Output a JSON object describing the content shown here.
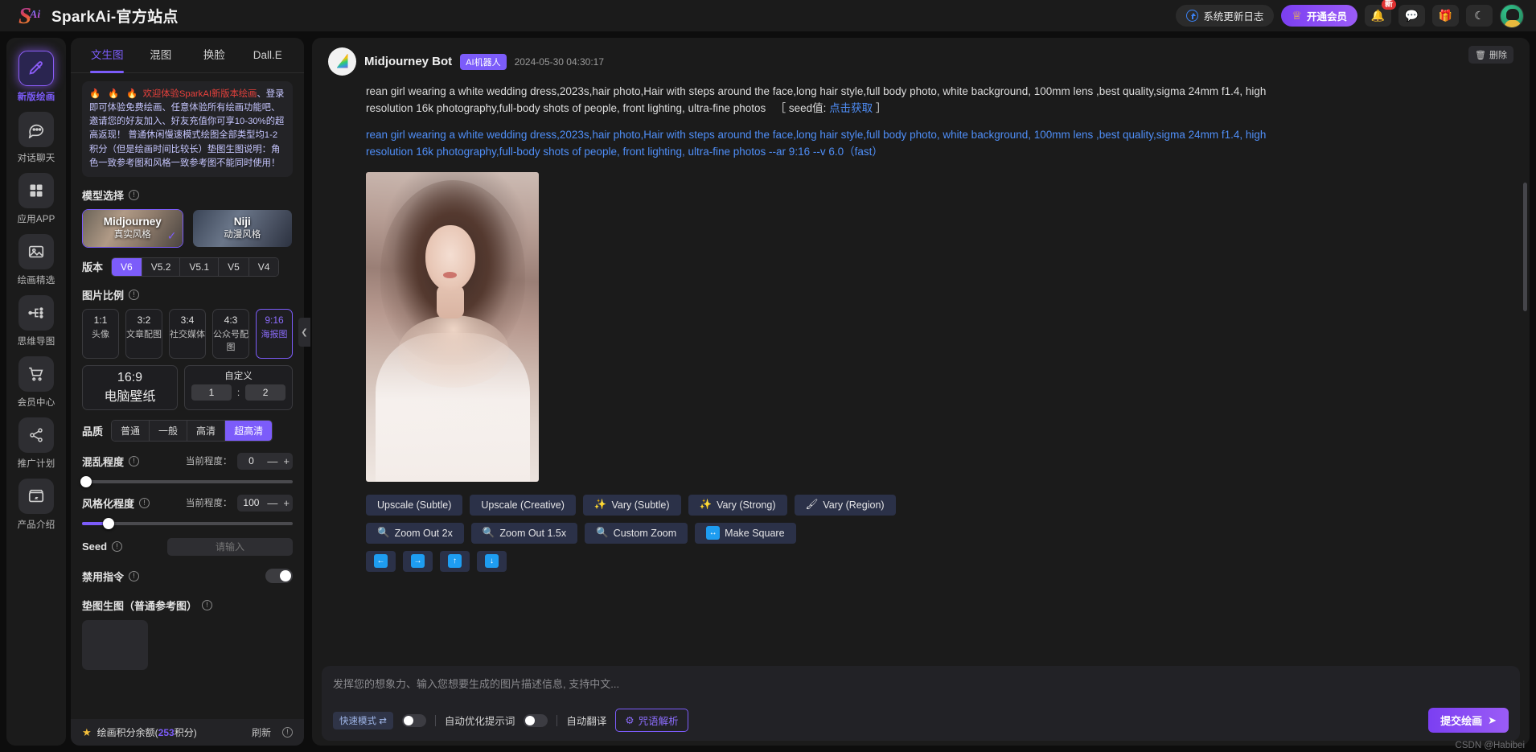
{
  "header": {
    "brand_title": "SparkAi-官方站点",
    "update_log": "系统更新日志",
    "vip": "开通会员",
    "bell_badge": "新",
    "icons": {
      "bell": "🔔",
      "wechat": "💬",
      "gift": "🎁",
      "moon": "☾"
    }
  },
  "sidebar": {
    "items": [
      {
        "label": "新版绘画",
        "icon": "brush-icon"
      },
      {
        "label": "对话聊天",
        "icon": "chat-icon"
      },
      {
        "label": "应用APP",
        "icon": "grid-icon"
      },
      {
        "label": "绘画精选",
        "icon": "image-icon"
      },
      {
        "label": "思维导图",
        "icon": "mindmap-icon"
      },
      {
        "label": "会员中心",
        "icon": "cart-icon"
      },
      {
        "label": "推广计划",
        "icon": "share-icon"
      },
      {
        "label": "产品介绍",
        "icon": "box-icon"
      }
    ],
    "active_index": 0
  },
  "panel": {
    "tabs": [
      "文生图",
      "混图",
      "换脸",
      "Dall.E"
    ],
    "active_tab": "文生图",
    "notice": {
      "fire": "🔥 🔥 🔥",
      "red_text": "欢迎体验SparkAI新版本绘画",
      "rest": "、登录即可体验免费绘画、任意体验所有绘画功能吧、邀请您的好友加入、好友充值你可享10-30%的超高返现！ 普通休闲慢速模式绘图全部类型均1-2积分（但是绘画时间比较长）垫图生图说明：角色一致参考图和风格一致参考图不能同时使用！"
    },
    "model_section_label": "模型选择",
    "models": [
      {
        "title": "Midjourney",
        "subtitle": "真实风格",
        "selected": true
      },
      {
        "title": "Niji",
        "subtitle": "动漫风格",
        "selected": false
      }
    ],
    "version_label": "版本",
    "versions": [
      "V6",
      "V5.2",
      "V5.1",
      "V5",
      "V4"
    ],
    "version_selected": "V6",
    "ratio_label": "图片比例",
    "ratios": [
      {
        "value": "1:1",
        "name": "头像",
        "selected": false
      },
      {
        "value": "3:2",
        "name": "文章配图",
        "selected": false
      },
      {
        "value": "3:4",
        "name": "社交媒体",
        "selected": false
      },
      {
        "value": "4:3",
        "name": "公众号配图",
        "selected": false
      },
      {
        "value": "9:16",
        "name": "海报图",
        "selected": true
      }
    ],
    "ratio_wide": {
      "value": "16:9",
      "name": "电脑壁纸"
    },
    "custom": {
      "label": "自定义",
      "w": "1",
      "h": "2",
      "colon": ":"
    },
    "quality_label": "品质",
    "qualities": [
      "普通",
      "一般",
      "高清",
      "超高清"
    ],
    "quality_selected": "超高清",
    "chaos": {
      "label": "混乱程度",
      "cur_label": "当前程度：",
      "value": "0",
      "minus": "—",
      "plus": "+",
      "percent": 0
    },
    "stylize": {
      "label": "风格化程度",
      "cur_label": "当前程度：",
      "value": "100",
      "minus": "—",
      "plus": "+",
      "percent": 12
    },
    "seed": {
      "label": "Seed",
      "placeholder": "请输入",
      "value": ""
    },
    "no_cmd_label": "禁用指令",
    "ref_label": "垫图生图（普通参考图）",
    "footer": {
      "text": "绘画积分余额(",
      "num": "253",
      "text2": "积分)",
      "refresh": "刷新"
    }
  },
  "main": {
    "bot_name": "Midjourney Bot",
    "bot_badge": "AI机器人",
    "timestamp": "2024-05-30 04:30:17",
    "delete_label": "删除",
    "prompt_plain": "rean girl wearing a white wedding dress,2023s,hair photo,Hair with steps around the face,long hair style,full body photo, white background, 100mm lens ,best quality,sigma 24mm f1.4, high resolution 16k photography,full-body shots of people, front lighting, ultra-fine photos",
    "seed_label": "［ seed值:",
    "seed_link": "点击获取",
    "seed_close": "］",
    "prompt_blue": "rean girl wearing a white wedding dress,2023s,hair photo,Hair with steps around the face,long hair style,full body photo, white background, 100mm lens ,best quality,sigma 24mm f1.4, high resolution 16k photography,full-body shots of people, front lighting, ultra-fine photos --ar 9:16 --v 6.0（fast）",
    "action_rows": [
      [
        {
          "label": "Upscale (Subtle)",
          "icon": ""
        },
        {
          "label": "Upscale (Creative)",
          "icon": ""
        },
        {
          "label": "Vary (Subtle)",
          "icon": "✨"
        },
        {
          "label": "Vary (Strong)",
          "icon": "✨"
        },
        {
          "label": "Vary (Region)",
          "icon": "🖌"
        }
      ],
      [
        {
          "label": "Zoom Out 2x",
          "icon": "🔍"
        },
        {
          "label": "Zoom Out 1.5x",
          "icon": "🔍"
        },
        {
          "label": "Custom Zoom",
          "icon": "🔍"
        },
        {
          "label": "Make Square",
          "icon": "↔"
        }
      ]
    ],
    "pan_buttons": [
      "←",
      "→",
      "↑",
      "↓"
    ]
  },
  "composer": {
    "placeholder": "发挥您的想象力、输入您想要生成的图片描述信息, 支持中文...",
    "mode_chip": "快速模式 ⇄",
    "auto_optimize": "自动优化提示词",
    "auto_translate": "自动翻译",
    "parse_button": "咒语解析",
    "parse_icon": "⚙",
    "submit_button": "提交绘画",
    "submit_icon": "➤"
  },
  "watermark": "CSDN @Habibei"
}
